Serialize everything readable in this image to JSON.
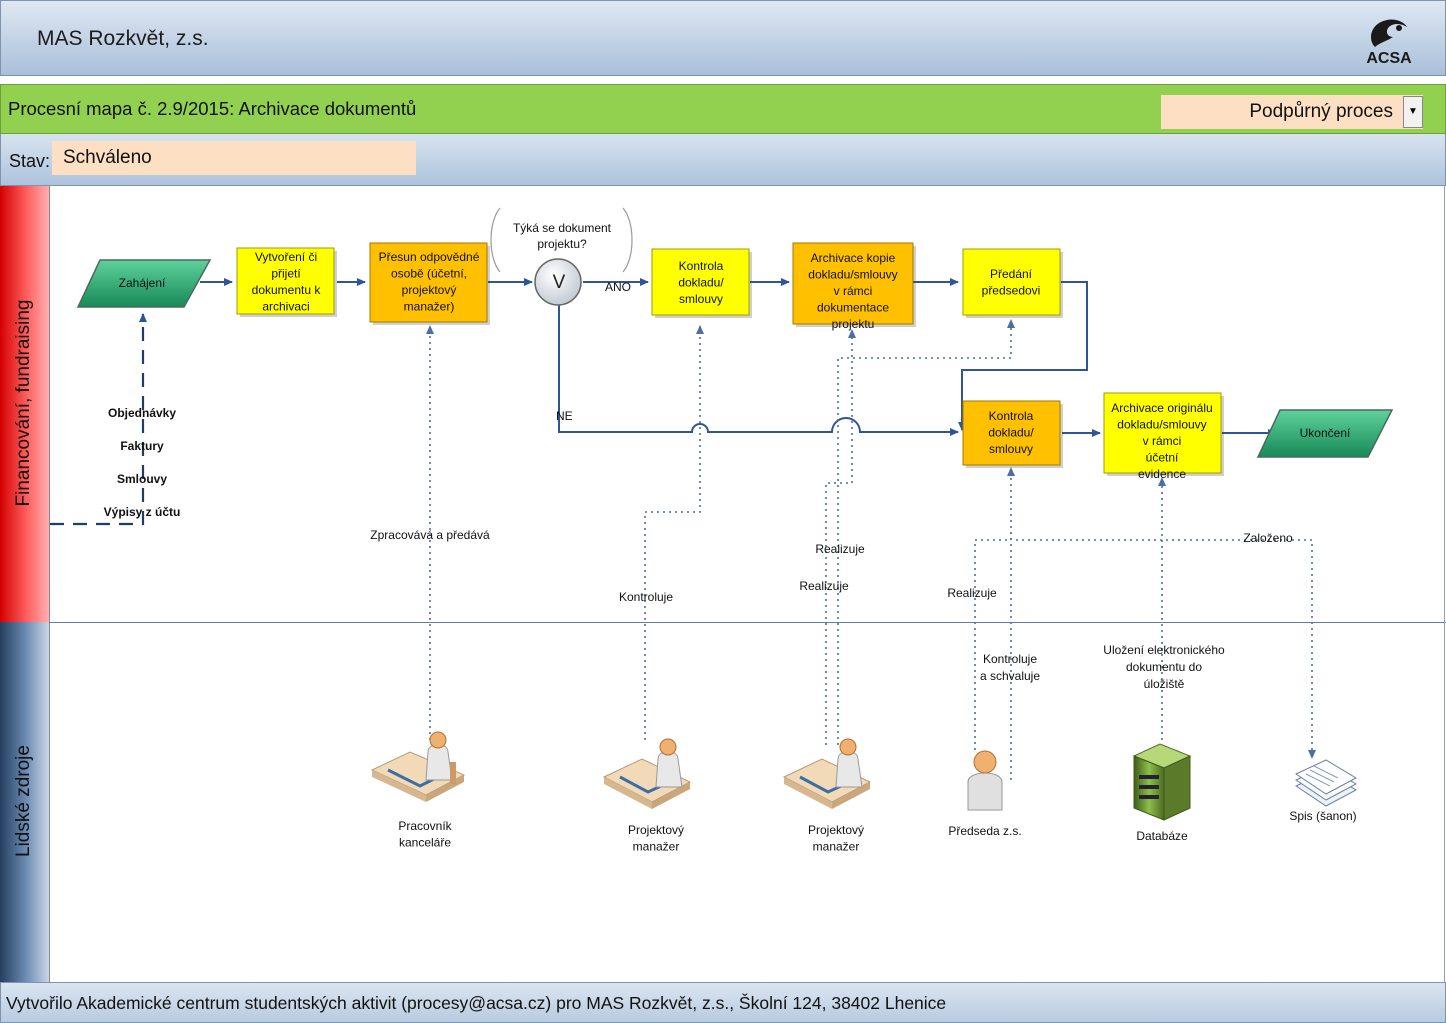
{
  "header": {
    "title": "MAS Rozkvět, z.s.",
    "logo_text": "ACSA"
  },
  "titlebar": {
    "title": "Procesní mapa č. 2.9/2015: Archivace dokumentů",
    "process_type": "Podpůrný proces"
  },
  "status": {
    "label": "Stav:",
    "value": "Schváleno"
  },
  "lanes": {
    "lane1": "Financování, fundraising",
    "lane2": "Lidské zdroje"
  },
  "nodes": {
    "start": "Zahájení",
    "create": "Vytvoření či přijetí dokumentu k archivaci",
    "transfer": "Přesun odpovědné osobě (účetní, projektový manažer)",
    "question": "Týká se dokument projektu?",
    "decision": "V",
    "check1": "Kontrola dokladu/ smlouvy",
    "archive_copy": "Archivace kopie dokladu/smlouvy v rámci dokumentace projektu",
    "hand_over": "Předání předsedovi",
    "check2": "Kontrola dokladu/ smlouvy",
    "archive_orig": "Archivace originálu dokladu/smlouvy v rámci účetní evidence",
    "end": "Ukončení"
  },
  "inputs": [
    "Objednávky",
    "Faktury",
    "Smlouvy",
    "Výpisy z účtu"
  ],
  "edges": {
    "yes": "ANO",
    "no": "NE"
  },
  "relations": {
    "r_transfer": "Zpracovává a předává",
    "r_check1": "Kontroluje",
    "r_pm2a": "Realizuje",
    "r_pm2b": "Realizuje",
    "r_chair": "Realizuje",
    "r_chair2": "Kontroluje a schvaluje",
    "r_db": "Uložení elektronického dokumentu do úložiště",
    "r_file": "Založeno"
  },
  "resources": {
    "office": "Pracovník kanceláře",
    "pm1": "Projektový manažer",
    "pm2": "Projektový manažer",
    "chair": "Předseda z.s.",
    "db": "Databáze",
    "file": "Spis (šanon)"
  },
  "colors": {
    "task_yellow": "#ffff00",
    "task_orange": "#ffc000",
    "terminal_green": "#2eaa72",
    "connector": "#2f5597",
    "dotted": "#4a6fa5"
  },
  "footer": {
    "text": "Vytvořilo Akademické centrum studentských aktivit (procesy@acsa.cz) pro MAS Rozkvět, z.s., Školní 124, 38402 Lhenice"
  }
}
